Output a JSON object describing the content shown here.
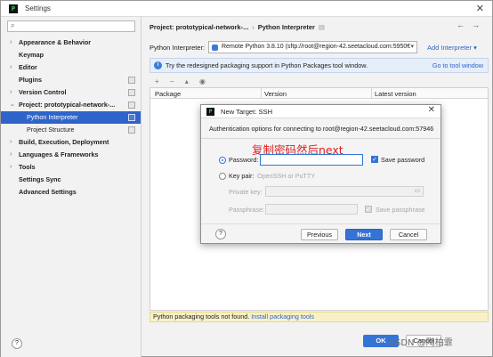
{
  "window": {
    "title": "Settings"
  },
  "sidebar": {
    "search_placeholder": "",
    "items": [
      {
        "label": "Appearance & Behavior",
        "chevron": "›",
        "badge": false
      },
      {
        "label": "Keymap",
        "chevron": "",
        "badge": false
      },
      {
        "label": "Editor",
        "chevron": "›",
        "badge": false
      },
      {
        "label": "Plugins",
        "chevron": "",
        "badge": true
      },
      {
        "label": "Version Control",
        "chevron": "›",
        "badge": true
      },
      {
        "label": "Project: prototypical-network-...",
        "chevron": "⌄",
        "badge": true
      },
      {
        "label": "Python Interpreter",
        "sub": true,
        "selected": true,
        "badge": true
      },
      {
        "label": "Project Structure",
        "sub": true,
        "badge": true
      },
      {
        "label": "Build, Execution, Deployment",
        "chevron": "›",
        "badge": false
      },
      {
        "label": "Languages & Frameworks",
        "chevron": "›",
        "badge": false
      },
      {
        "label": "Tools",
        "chevron": "›",
        "badge": false
      },
      {
        "label": "Settings Sync",
        "chevron": "",
        "badge": false
      },
      {
        "label": "Advanced Settings",
        "chevron": "",
        "badge": false
      }
    ]
  },
  "main": {
    "breadcrumb_project": "Project: prototypical-network-...",
    "breadcrumb_sep": "›",
    "breadcrumb_page": "Python Interpreter",
    "interpreter_label": "Python Interpreter:",
    "interpreter_value": "Remote Python 3.8.10 (sftp://root@region-42.seetacloud.com:5950€",
    "add_interpreter": "Add Interpreter ▾",
    "notice_text": "Try the redesigned packaging support in Python Packages tool window.",
    "notice_link": "Go to tool window",
    "toolbar": "+ − ▴ ◉",
    "columns": [
      "Package",
      "Version",
      "Latest version"
    ],
    "warning_text": "Python packaging tools not found.",
    "warning_link": "Install packaging tools",
    "ok_label": "OK",
    "cancel_label": "Cancel"
  },
  "dialog": {
    "title": "New Target: SSH",
    "description": "Authentication options for connecting to root@region-42.seetacloud.com:57946",
    "annotation": "复制密码然后next",
    "password_label": "Password:",
    "password_value": "",
    "save_password_label": "Save password",
    "keypair_label": "Key pair:",
    "keypair_hint": "OpenSSH or PuTTY",
    "private_key_label": "Private key:",
    "passphrase_label": "Passphrase:",
    "save_passphrase_label": "Save passphrase",
    "help_label": "?",
    "previous_label": "Previous",
    "next_label": "Next",
    "cancel_label": "Cancel"
  },
  "watermark": "CSDN @陶柏霏",
  "colors": {
    "accent": "#3574d6",
    "selection": "#2f65ca",
    "annotation": "#e02020"
  }
}
